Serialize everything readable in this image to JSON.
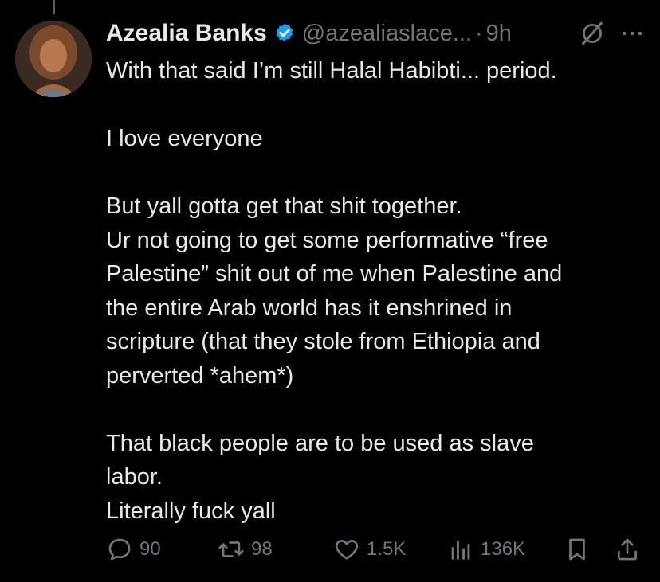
{
  "tweet": {
    "author_name": "Azealia Banks",
    "handle": "@azealiaslace...",
    "separator": "·",
    "time": "9h",
    "lines": [
      "With that said I’m still Halal Habibti... period.",
      "",
      "I love everyone",
      "",
      "But yall gotta get that shit together.",
      "Ur not going to get some performative “free",
      "Palestine” shit out of me when Palestine and",
      "the entire Arab world has it enshrined in",
      "scripture (that they stole from Ethiopia and",
      "perverted *ahem*)",
      "",
      "That black people are to be used as slave",
      "labor.",
      "Literally fuck yall"
    ]
  },
  "actions": {
    "replies": "90",
    "reposts": "98",
    "likes": "1.5K",
    "views": "136K"
  },
  "icons": {
    "verified": "verified-badge-icon",
    "grok": "grok-icon",
    "more": "more-icon",
    "reply": "reply-icon",
    "repost": "repost-icon",
    "like": "like-icon",
    "views": "views-icon",
    "bookmark": "bookmark-icon",
    "share": "share-icon"
  },
  "colors": {
    "background": "#000000",
    "text": "#e7e9ea",
    "muted": "#71767b",
    "verified": "#1d9bf0"
  }
}
